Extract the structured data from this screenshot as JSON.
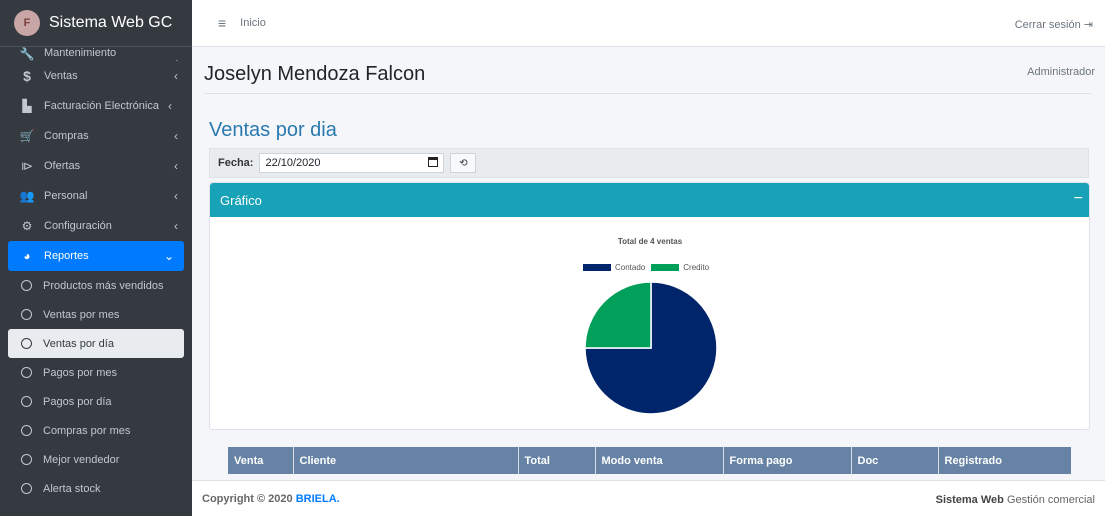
{
  "brand": {
    "logo_text": "F",
    "title": "Sistema Web GC"
  },
  "sidebar": {
    "items": [
      {
        "label": "Mantenimiento",
        "icon": "wrench-icon"
      },
      {
        "label": "Ventas",
        "icon": "dollar-icon"
      },
      {
        "label": "Facturación Electrónica",
        "icon": "building-icon"
      },
      {
        "label": "Compras",
        "icon": "cart-icon"
      },
      {
        "label": "Ofertas",
        "icon": "tags-icon"
      },
      {
        "label": "Personal",
        "icon": "users-icon"
      },
      {
        "label": "Configuración",
        "icon": "cog-icon"
      },
      {
        "label": "Reportes",
        "icon": "chart-pie-icon"
      }
    ],
    "submenu": [
      "Productos más vendidos",
      "Ventas por mes",
      "Ventas por día",
      "Pagos por mes",
      "Pagos por día",
      "Compras por mes",
      "Mejor vendedor",
      "Alerta stock"
    ]
  },
  "topbar": {
    "home": "Inicio",
    "logout": "Cerrar sesión"
  },
  "user": {
    "name": "Joselyn Mendoza Falcon",
    "role": "Administrador"
  },
  "page": {
    "title": "Ventas por dia"
  },
  "filter": {
    "label": "Fecha:",
    "date_value": "22/10/2020"
  },
  "card": {
    "title": "Gráfico"
  },
  "chart_data": {
    "type": "pie",
    "title": "Total de 4 ventas",
    "categories": [
      "Contado",
      "Credito"
    ],
    "values": [
      3,
      1
    ],
    "colors": [
      "#00256a",
      "#00a05a"
    ],
    "legend": "top"
  },
  "table": {
    "headers": [
      "Venta",
      "Cliente",
      "Total",
      "Modo venta",
      "Forma pago",
      "Doc",
      "Registrado"
    ]
  },
  "footer": {
    "copyright": "Copyright © 2020",
    "brand": "BRIELA.",
    "system_bold": "Sistema Web",
    "system_rest": "Gestión comercial"
  }
}
